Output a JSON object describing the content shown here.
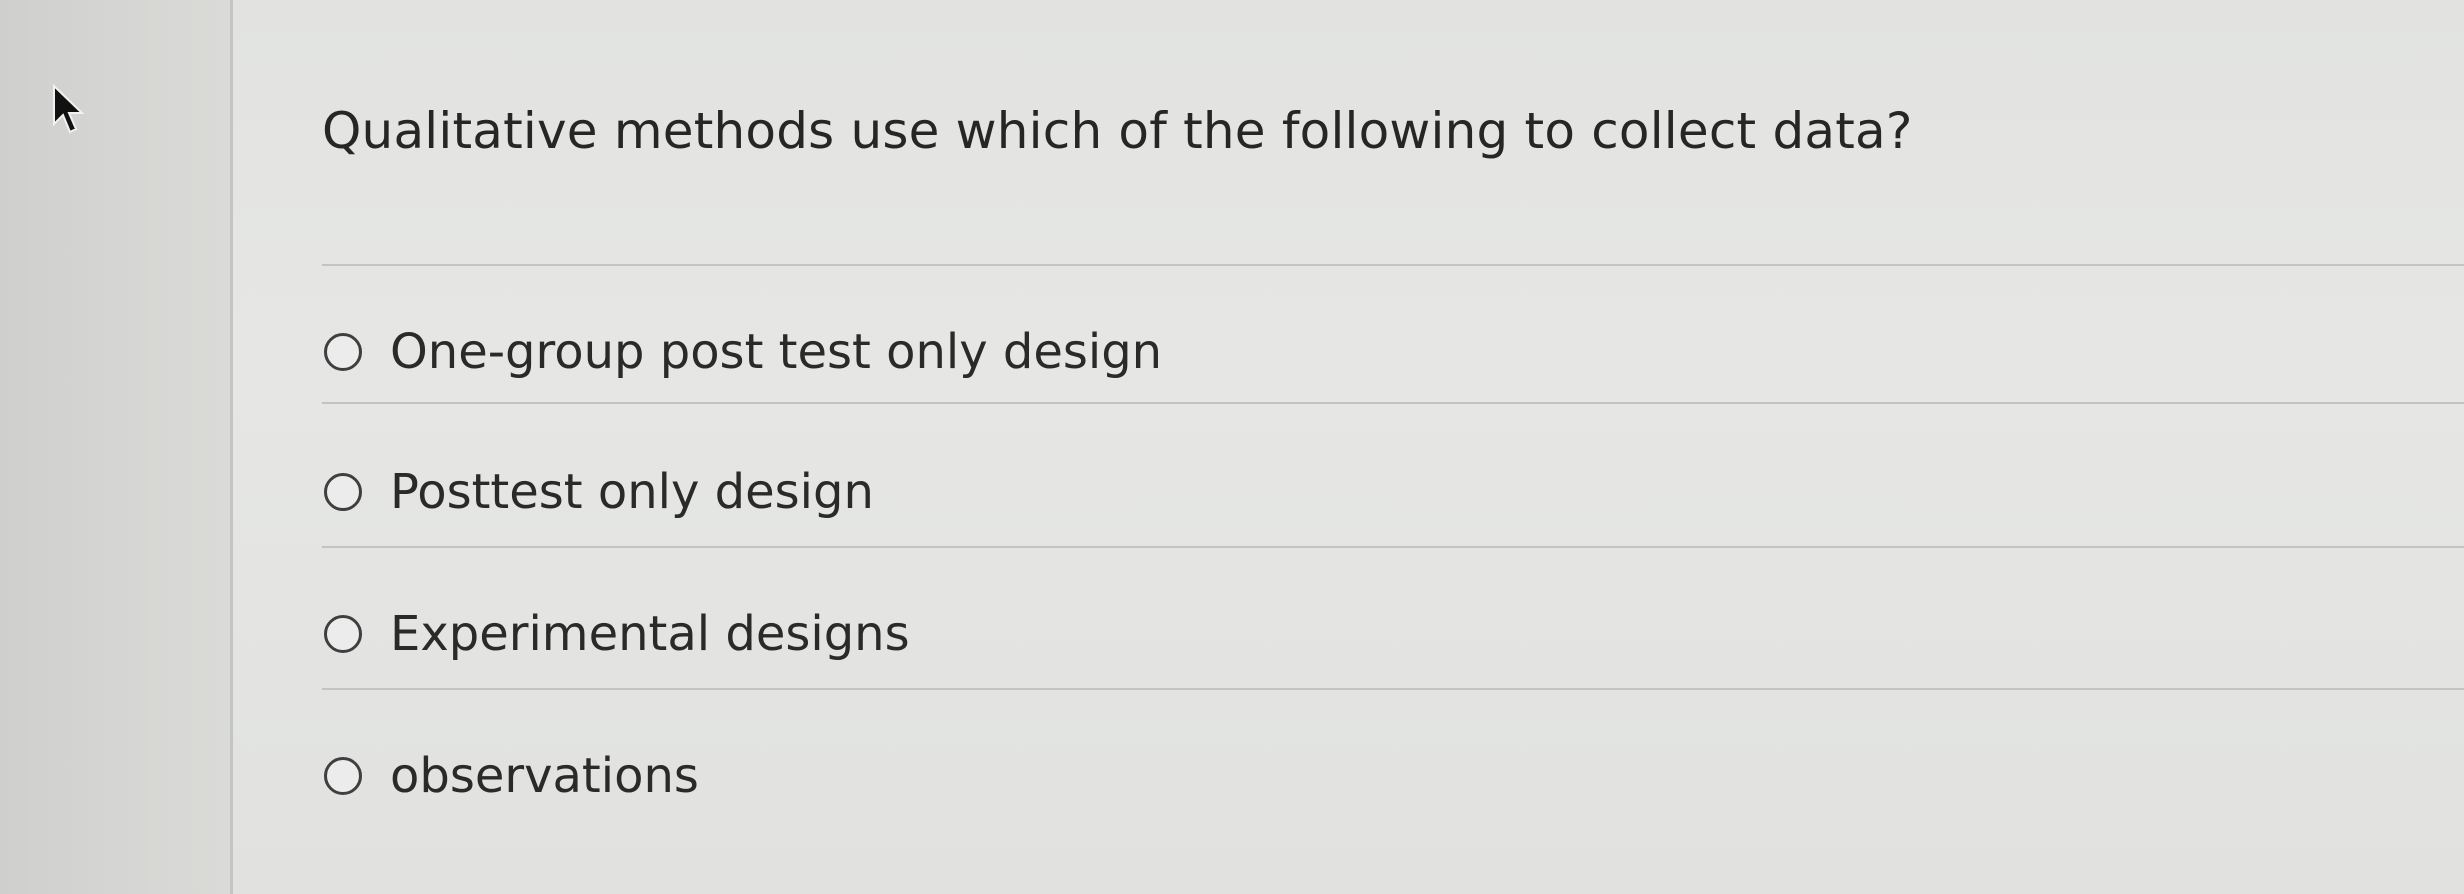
{
  "question": {
    "title": "Qualitative methods use which of the following to collect data?"
  },
  "options": [
    {
      "label": "One-group post test only design",
      "selected": false
    },
    {
      "label": "Posttest only design",
      "selected": false
    },
    {
      "label": "Experimental designs",
      "selected": false
    },
    {
      "label": "observations",
      "selected": false
    }
  ],
  "icons": {
    "cursor": "mouse-pointer-icon",
    "radio": "radio-button-icon"
  }
}
